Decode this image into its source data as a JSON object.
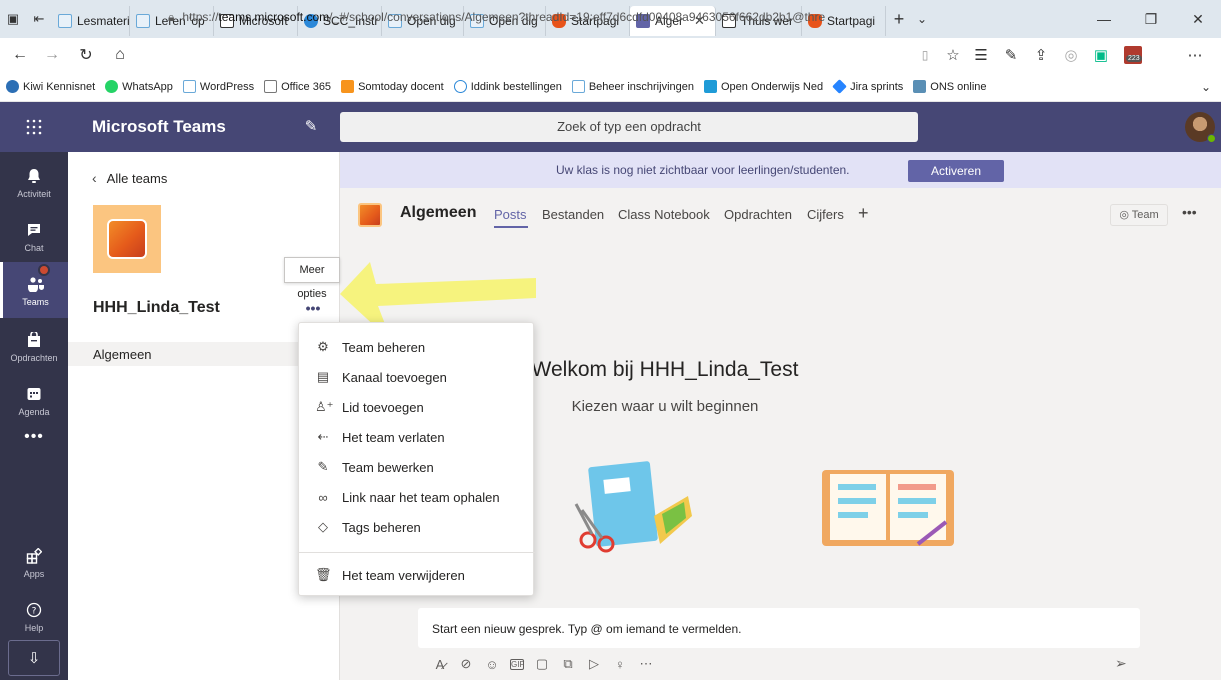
{
  "browser": {
    "tabs": [
      {
        "label": "Lesmateri",
        "color": "#6aa9d8"
      },
      {
        "label": "Leren 'op",
        "color": "#6aa9d8"
      },
      {
        "label": "Microsoft",
        "color": "#ffffff"
      },
      {
        "label": "SCC_Instr",
        "color": "#2b88d8"
      },
      {
        "label": "Open dig",
        "color": "#6aa9d8"
      },
      {
        "label": "Open dig",
        "color": "#6aa9d8"
      },
      {
        "label": "Startpagi",
        "color": "#e8531a"
      },
      {
        "label": "Alger",
        "color": "#6264a7",
        "active": true
      },
      {
        "label": "Thuis wer",
        "color": "#ffffff"
      },
      {
        "label": "Startpagi",
        "color": "#e8531a"
      }
    ],
    "url_prefix": "https://",
    "url_host": "teams.microsoft.com",
    "url_rest": "/_#/school/conversations/Algemeen?threadId=19:eff7d6cdfd00408a9463056f662db2b1@thre",
    "favorites": [
      {
        "label": "Kiwi Kennisnet",
        "color": "#2c6fb5"
      },
      {
        "label": "WhatsApp",
        "color": "#25d366"
      },
      {
        "label": "WordPress",
        "color": "#6aa9d8"
      },
      {
        "label": "Office 365",
        "color": "#777777"
      },
      {
        "label": "Somtoday docent",
        "color": "#f7941d"
      },
      {
        "label": "Iddink bestellingen",
        "color": "#2b88d8"
      },
      {
        "label": "Beheer inschrijvingen",
        "color": "#6aa9d8"
      },
      {
        "label": "Open Onderwijs Ned",
        "color": "#1f9bd7"
      },
      {
        "label": "Jira sprints",
        "color": "#2684ff"
      },
      {
        "label": "ONS online",
        "color": "#5a8fb5"
      }
    ],
    "profile_badge": "223"
  },
  "teams": {
    "app_title": "Microsoft Teams",
    "search_placeholder": "Zoek of typ een opdracht",
    "accent": "#464775",
    "appbar": [
      {
        "label": "Activiteit",
        "icon": "bell-icon"
      },
      {
        "label": "Chat",
        "icon": "chat-icon"
      },
      {
        "label": "Teams",
        "icon": "teams-icon",
        "active": true
      },
      {
        "label": "Opdrachten",
        "icon": "assignments-icon"
      },
      {
        "label": "Agenda",
        "icon": "calendar-icon"
      },
      {
        "label": "Apps",
        "icon": "apps-icon"
      },
      {
        "label": "Help",
        "icon": "help-icon"
      }
    ],
    "left": {
      "back": "Alle teams",
      "team_name": "HHH_Linda_Test",
      "channel": "Algemeen",
      "tooltip": "Meer opties"
    },
    "banner": {
      "text": "Uw klas is nog niet zichtbaar voor leerlingen/studenten.",
      "button": "Activeren"
    },
    "channel_header": {
      "title": "Algemeen",
      "tabs": [
        "Posts",
        "Bestanden",
        "Class Notebook",
        "Opdrachten",
        "Cijfers"
      ],
      "team_button": "Team"
    },
    "welcome": {
      "title": "Welkom bij HHH_Linda_Test",
      "subtitle": "Kiezen waar u wilt beginnen"
    },
    "compose_placeholder": "Start een nieuw gesprek. Typ @ om iemand te vermelden.",
    "menu": [
      {
        "label": "Team beheren",
        "icon": "settings-icon"
      },
      {
        "label": "Kanaal toevoegen",
        "icon": "add-channel-icon"
      },
      {
        "label": "Lid toevoegen",
        "icon": "add-member-icon"
      },
      {
        "label": "Het team verlaten",
        "icon": "leave-icon"
      },
      {
        "label": "Team bewerken",
        "icon": "edit-icon"
      },
      {
        "label": "Link naar het team ophalen",
        "icon": "link-icon"
      },
      {
        "label": "Tags beheren",
        "icon": "tag-icon"
      },
      {
        "label": "Het team verwijderen",
        "icon": "delete-icon"
      }
    ]
  }
}
